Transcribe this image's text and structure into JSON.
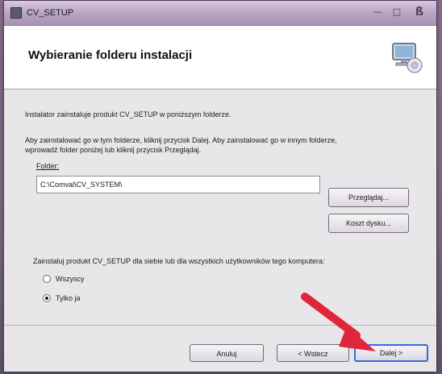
{
  "window": {
    "title": "CV_SETUP",
    "controls": {
      "minimize": "—",
      "maximize": "□",
      "close": "ß"
    }
  },
  "header": {
    "title": "Wybieranie folderu instalacji",
    "icon": "computer-cd-icon"
  },
  "body": {
    "intro": "Instalator zainstaluje produkt CV_SETUP w poniższym folderze.",
    "instructions_line1": "Aby zainstalować go w tym folderze, kliknij przycisk Dalej. Aby zainstalować go w innym folderze,",
    "instructions_line2": "wprowadź folder poniżej lub kliknij przycisk Przeglądaj.",
    "folder_label": "Folder:",
    "folder_value": "C:\\Comval\\CV_SYSTEM\\",
    "browse_button": "Przeglądaj...",
    "disk_cost_button": "Koszt dysku...",
    "install_for_label": "Zainstaluj produkt CV_SETUP dla siebie lub dla wszystkich użytkowników tego komputera:",
    "options": [
      {
        "label": "Wszyscy",
        "selected": false
      },
      {
        "label": "Tylko ja",
        "selected": true
      }
    ]
  },
  "footer": {
    "cancel_button": "Anuluj",
    "back_button": "< Wstecz",
    "next_button": "Dalej >"
  },
  "colors": {
    "annotation_arrow": "#e0263a",
    "focus_border": "#2f6fd6"
  }
}
